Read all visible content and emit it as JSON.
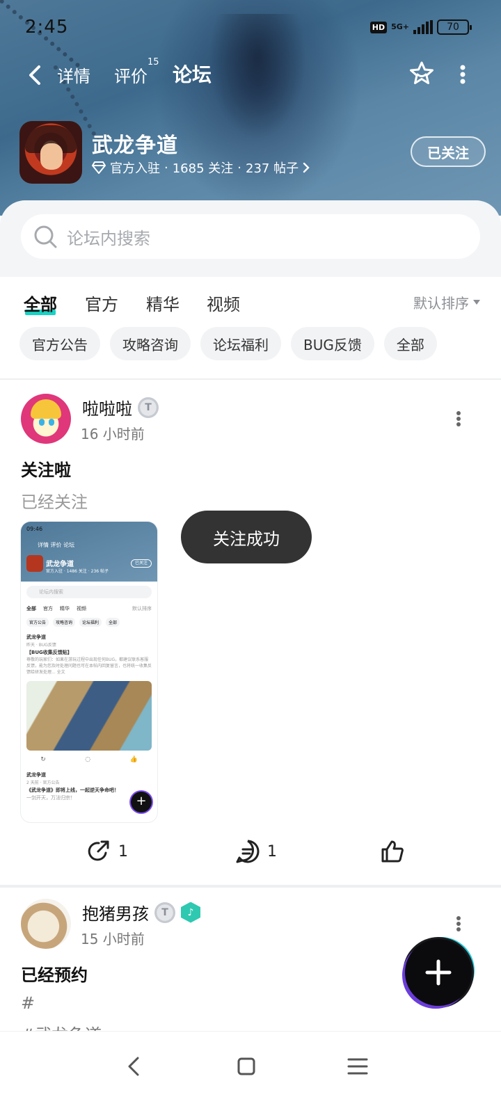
{
  "status_bar": {
    "time": "2:45",
    "hd": "HD",
    "network": "5G+",
    "battery": "70"
  },
  "nav": {
    "tabs": [
      {
        "label": "详情"
      },
      {
        "label": "评价",
        "count": "15"
      },
      {
        "label": "论坛"
      }
    ]
  },
  "game": {
    "name": "武龙争道",
    "verified_label": "官方入驻",
    "followers": "1685 关注",
    "posts": "237 帖子",
    "follow_button": "已关注"
  },
  "search": {
    "placeholder": "论坛内搜索"
  },
  "filters": {
    "tabs": [
      "全部",
      "官方",
      "精华",
      "视频"
    ],
    "sort": "默认排序",
    "chips": [
      "官方公告",
      "攻略咨询",
      "论坛福利",
      "BUG反馈",
      "全部"
    ]
  },
  "posts": [
    {
      "author": "啦啦啦",
      "level": "T",
      "time": "16 小时前",
      "title": "关注啦",
      "text": "已经关注",
      "shares": "1",
      "comments": "1",
      "thumbnail": {
        "time": "09:46",
        "tabs": "详情  评价  论坛",
        "game_name": "武龙争道",
        "stats": "官方入驻 · 1486 关注 · 236 帖子",
        "follow": "已关注",
        "search": "论坛内搜索",
        "tabs2": [
          "全部",
          "官方",
          "精华",
          "视频"
        ],
        "sort": "默认排序",
        "chips": [
          "官方公告",
          "攻略咨询",
          "论坛福利",
          "全部"
        ],
        "post_author": "武龙争道",
        "post_meta": "昨天 · BUG反馈",
        "post_title": "【BUG收集反馈贴】",
        "post_text": "尊敬的玩家们：如果在游玩过程中出现任何BUG，都建议联系客服反馈，能为您及时处理问题也可在本帖内回复留言，也将统一收集反馈给研发处理...  全文",
        "post2_author": "武龙争道",
        "post2_meta": "2 天前 · 官方公告",
        "post2_title": "《武龙争道》即将上线，一起逆天争命吧！",
        "post2_text": "一剑开天，万法归宗！"
      }
    },
    {
      "author": "抱猪男孩",
      "level": "T",
      "badge": "♪",
      "time": "15 小时前",
      "title": "已经预约",
      "text": "#",
      "text2": "#武龙争道"
    }
  ],
  "toast": "关注成功",
  "fab": "+"
}
